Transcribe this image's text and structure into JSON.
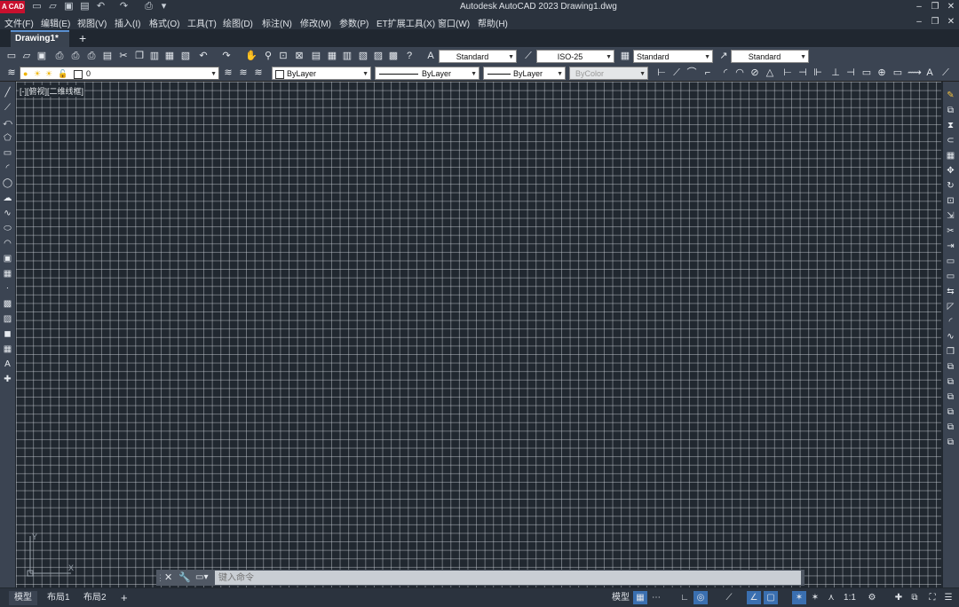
{
  "app": {
    "logo_text": "CAD",
    "window_title": "Autodesk AutoCAD 2023    Drawing1.dwg"
  },
  "menu": [
    "文件(F)",
    "编辑(E)",
    "视图(V)",
    "插入(I)",
    "格式(O)",
    "工具(T)",
    "绘图(D)",
    "标注(N)",
    "修改(M)",
    "参数(P)",
    "ET扩展工具(X)",
    "窗口(W)",
    "帮助(H)"
  ],
  "tabs": {
    "active": "Drawing1*",
    "new": "+"
  },
  "styles": {
    "text_style": "Standard",
    "dim_style": "ISO-25",
    "table_style": "Standard",
    "mleader_style": "Standard"
  },
  "properties": {
    "layer": "0",
    "color": "ByLayer",
    "linetype": "ByLayer",
    "lineweight": "ByLayer",
    "plotstyle": "ByColor"
  },
  "viewport": {
    "label": "[-][俯视][二维线框]"
  },
  "command": {
    "placeholder": "键入命令"
  },
  "layout_tabs": [
    "模型",
    "布局1",
    "布局2"
  ],
  "status": {
    "model": "模型",
    "scale": "1:1"
  },
  "colors": {
    "canvas": "#212830",
    "grid": "#d2d7de",
    "toolbar": "#3b4452",
    "accent": "#3a6fb0"
  }
}
